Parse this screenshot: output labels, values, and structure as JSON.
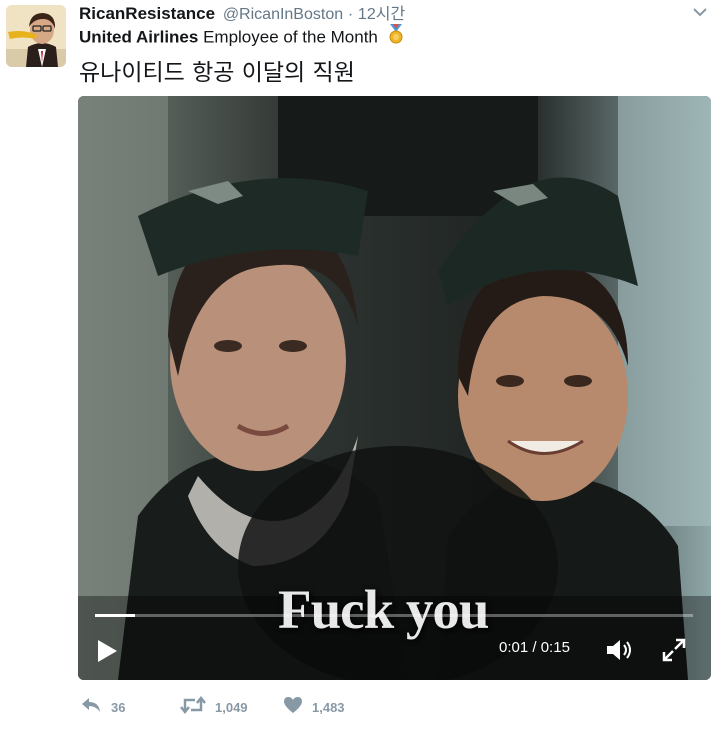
{
  "tweet": {
    "display_name": "RicanResistance",
    "handle": "@RicanInBoston",
    "separator": "·",
    "time": "12시간",
    "text_bold": "United Airlines",
    "text_rest": " Employee of the Month",
    "emoji": "medal-icon",
    "text_korean": "유나이티드 항공 이달의 직원"
  },
  "video": {
    "caption": "Fuck you",
    "current_time": "0:01",
    "duration": "0:15",
    "time_separator": " / ",
    "progress_fraction": 0.0667,
    "icons": [
      "play-icon",
      "volume-icon",
      "fullscreen-icon"
    ]
  },
  "actions": {
    "reply_count": "36",
    "retweet_count": "1,049",
    "like_count": "1,483",
    "icons": [
      "reply-icon",
      "retweet-icon",
      "heart-icon"
    ]
  },
  "colors": {
    "text": "#14171a",
    "secondary": "#657786",
    "action_gray": "#8899a6",
    "medal_ribbon": "#4a9ad8",
    "medal_gold": "#f0b429"
  }
}
